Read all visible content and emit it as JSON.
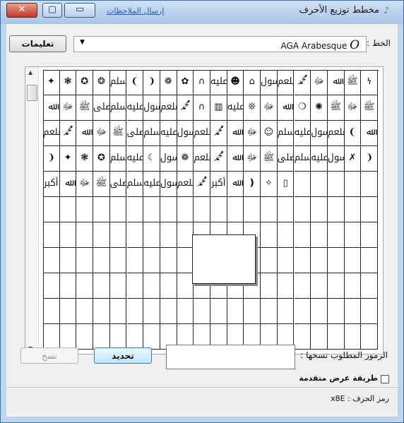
{
  "window": {
    "title": "مخطط توزيع الأحرف",
    "feedback_link": "إرسال الملاحظات",
    "buttons": {
      "close": "✕",
      "maximize": "▢",
      "minimize": "▭"
    }
  },
  "toolbar": {
    "font_label": "الخط :",
    "font_value": "AGA Arabesque",
    "font_type_glyph": "O",
    "help_button": "تعليمات"
  },
  "grid": {
    "rows": 11,
    "cols": 20,
    "glyph_rows": [
      [
        "𐓏",
        "ﷺ",
        "ﷲ",
        "ﷻ",
        "ﷴ",
        "ﷵ",
        "ﷶ",
        "⌂",
        "☻",
        "ﷷ",
        "∩",
        "✿",
        "❁",
        "❩",
        "❨",
        "ﷸ",
        "❂",
        "✪",
        "❃",
        "✦",
        "ﷹ"
      ],
      [
        "ﷺ",
        "ﷻ",
        "ﷺ",
        "✺",
        "❍",
        "ﷲ",
        "ﷻ",
        "❊",
        "ﷷ",
        "▥",
        "∩",
        "ﷴ",
        "ﷵ",
        "ﷶ",
        "ﷷ",
        "ﷸ",
        "ﷹ",
        "ﷺ",
        "ﷻ",
        "ﷲ"
      ],
      [
        "ﷲ",
        "❨",
        "ﷵ",
        "ﷶ",
        "ﷷ",
        "ﷸ",
        "☺",
        "ﷻ",
        "ﷲ",
        "ﷴ",
        "ﷵ",
        "ﷶ",
        "ﷷ",
        "ﷸ",
        "ﷹ",
        "ﷺ",
        "ﷻ",
        "ﷲ",
        "ﷴ",
        "ﷵ"
      ],
      [
        "❩",
        "✗",
        "ﷶ",
        "ﷷ",
        "ﷸ",
        "ﷹ",
        "ﷺ",
        "ﷻ",
        "ﷲ",
        "ﷴ",
        "ﷵ",
        "❁",
        "ﷶ",
        "☾",
        "ﷷ",
        "ﷸ",
        "✪",
        "❃",
        "✦",
        "❩"
      ],
      [
        "",
        "",
        "",
        "",
        "",
        "▯",
        "✧",
        "❫",
        "ﷲ",
        "ﷳ",
        "ﷴ",
        "ﷵ",
        "ﷶ",
        "ﷷ",
        "ﷸ",
        "ﷹ",
        "ﷺ",
        "ﷻ",
        "ﷲ",
        "ﷳ"
      ]
    ]
  },
  "copy_section": {
    "label": "الرموز المطلوب نسخها :",
    "input_value": "",
    "select_button": "تحديد",
    "copy_button": "نسخ"
  },
  "advanced": {
    "checkbox_label": "طريقة عرض متقدمة",
    "checked": false
  },
  "status": {
    "char_code": "رمز الحرف : x8E"
  }
}
